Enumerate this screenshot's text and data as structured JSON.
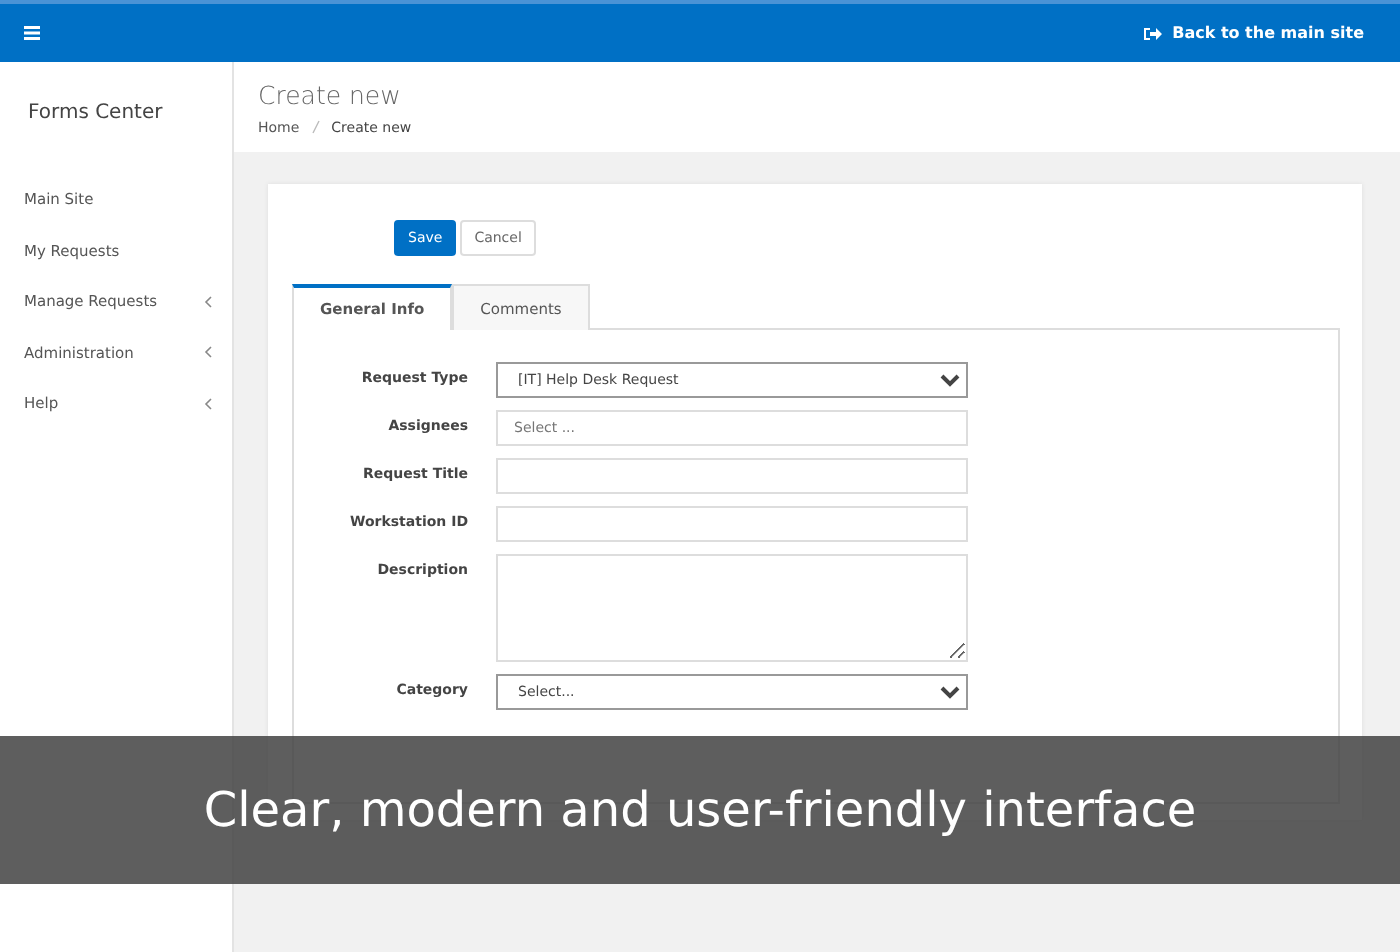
{
  "header": {
    "back_link": "Back to the main site"
  },
  "sidebar": {
    "title": "Forms Center",
    "items": [
      {
        "label": "Main Site",
        "expandable": false
      },
      {
        "label": "My Requests",
        "expandable": false
      },
      {
        "label": "Manage Requests",
        "expandable": true
      },
      {
        "label": "Administration",
        "expandable": true
      },
      {
        "label": "Help",
        "expandable": true
      }
    ]
  },
  "page": {
    "title": "Create new",
    "breadcrumb": [
      {
        "label": "Home",
        "kind": "link"
      },
      {
        "label": "Create new",
        "kind": "current"
      }
    ]
  },
  "actions": [
    {
      "label": "Save",
      "kind": "primary"
    },
    {
      "label": "Cancel",
      "kind": "default"
    }
  ],
  "tabs": [
    {
      "label": "General Info",
      "selected": true
    },
    {
      "label": "Comments",
      "selected": false
    }
  ],
  "fields": [
    {
      "label": "Request Type",
      "kind": "select",
      "value": "[IT] Help Desk Request"
    },
    {
      "label": "Assignees",
      "kind": "picker",
      "placeholder": "Select ..."
    },
    {
      "label": "Request Title",
      "kind": "text"
    },
    {
      "label": "Workstation ID",
      "kind": "text"
    },
    {
      "label": "Description",
      "kind": "textarea"
    },
    {
      "label": "Category",
      "kind": "select",
      "value": "Select..."
    }
  ],
  "caption": "Clear, modern and user-friendly interface"
}
